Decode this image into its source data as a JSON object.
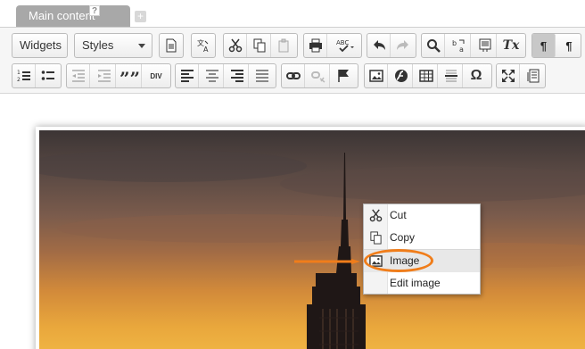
{
  "tabs": {
    "active_label": "Main content",
    "help_glyph": "?",
    "add_glyph": "+"
  },
  "toolbar": {
    "widgets_label": "Widgets",
    "styles_label": "Styles",
    "row1_icons": [
      "document-icon",
      "spellcheck-language-icon",
      "cut-icon",
      "copy-icon",
      "paste-icon",
      "print-icon",
      "spellcheck-icon",
      "undo-icon",
      "redo-icon",
      "search-icon",
      "replace-icon",
      "paste-text-icon",
      "remove-format-icon",
      "ltr-icon",
      "rtl-icon"
    ],
    "row2_icons": [
      "numbered-list-icon",
      "bulleted-list-icon",
      "outdent-icon",
      "indent-icon",
      "blockquote-icon",
      "div-icon",
      "align-left-icon",
      "align-center-icon",
      "align-right-icon",
      "justify-icon",
      "link-icon",
      "unlink-icon",
      "anchor-icon",
      "image-icon",
      "flash-icon",
      "table-icon",
      "horizontal-rule-icon",
      "special-char-icon",
      "maximize-icon",
      "show-blocks-icon"
    ],
    "blockquote_glyph": "””",
    "div_glyph": "DIV",
    "omega_glyph": "Ω",
    "format_glyph": "Tx",
    "ltr_glyph": "¶",
    "rtl_glyph": "¶"
  },
  "context_menu": {
    "items": [
      {
        "label": "Cut",
        "icon": "cut-icon"
      },
      {
        "label": "Copy",
        "icon": "copy-icon"
      },
      {
        "label": "Image",
        "icon": "image-icon"
      },
      {
        "label": "Edit image",
        "icon": ""
      }
    ],
    "highlighted_item": "Image"
  },
  "colors": {
    "annotation": "#f07d1a",
    "tab_bg": "#a8a8a8",
    "toolbar_bg": "#f6f6f6"
  }
}
